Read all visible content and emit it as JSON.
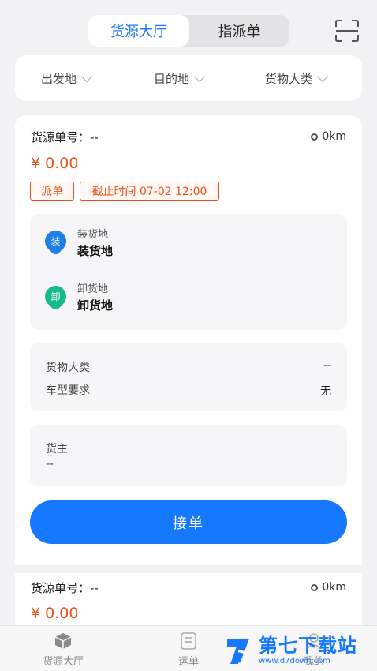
{
  "header": {
    "tabs": [
      {
        "label": "货源大厅",
        "active": true
      },
      {
        "label": "指派单",
        "active": false
      }
    ],
    "scan_icon": "scan-icon"
  },
  "filters": [
    {
      "label": "出发地"
    },
    {
      "label": "目的地"
    },
    {
      "label": "货物大类"
    }
  ],
  "cards": [
    {
      "order_label": "货源单号：--",
      "distance": "0km",
      "price": "¥ 0.00",
      "tags": [
        "派单",
        "截止时间 07-02 12:00"
      ],
      "load": {
        "icon_text": "装",
        "label": "装货地",
        "value": "装货地"
      },
      "unload": {
        "icon_text": "卸",
        "label": "卸货地",
        "value": "卸货地"
      },
      "cargo_category_label": "货物大类",
      "cargo_category_value": "--",
      "vehicle_req_label": "车型要求",
      "vehicle_req_value": "无",
      "shipper_label": "货主",
      "shipper_value": "--",
      "accept_label": "接单"
    },
    {
      "order_label": "货源单号：--",
      "distance": "0km",
      "price": "¥ 0.00"
    }
  ],
  "tabbar": [
    {
      "label": "货源大厅",
      "icon": "cube-icon",
      "active": true
    },
    {
      "label": "运单",
      "icon": "waybill-icon",
      "active": false
    },
    {
      "label": "我的",
      "icon": "user-icon",
      "active": false
    }
  ],
  "watermark": {
    "title": "第七下载站",
    "url": "www.d7down.com"
  },
  "colors": {
    "accent": "#1677ff",
    "price": "#e5531a",
    "load_icon": "#1f7fe6",
    "unload_icon": "#16b98a"
  }
}
